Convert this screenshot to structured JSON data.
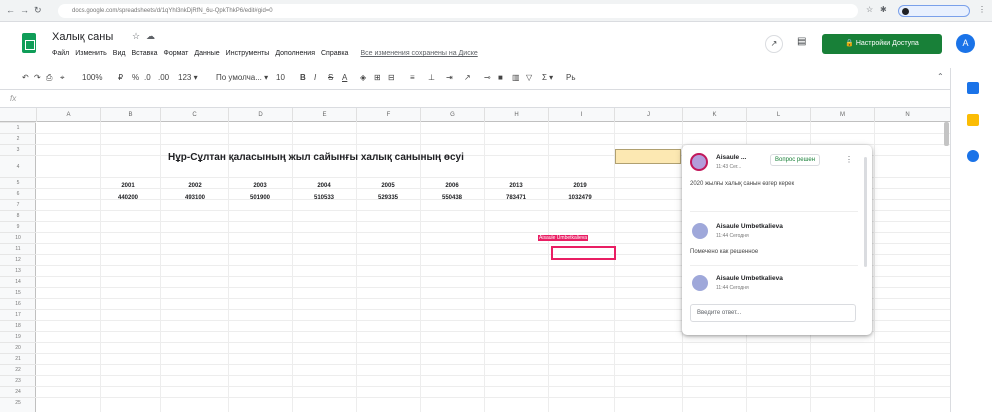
{
  "browser": {
    "url": "docs.google.com/spreadsheets/d/1qYhl3nkDjRfN_6u-QpkThkP6/edit#gid=0",
    "back_icon": "arrow-left-icon",
    "forward_icon": "arrow-right-icon",
    "reload_icon": "reload-icon"
  },
  "header": {
    "title": "Халық саны",
    "menu": [
      "Файл",
      "Изменить",
      "Вид",
      "Вставка",
      "Формат",
      "Данные",
      "Инструменты",
      "Дополнения",
      "Справка"
    ],
    "last_edit": "Все изменения сохранены на Диске",
    "share_label": "Настройки Доступа",
    "avatar_letter": "A"
  },
  "toolbar": {
    "zoom": "100%",
    "currency": "₽",
    "percent": "%",
    "dec0": ".0",
    "dec00": ".00",
    "fmt": "123 ▾",
    "font": "По умолча... ▾",
    "font_size": "10",
    "bold": "B",
    "italic": "I",
    "strike": "S",
    "text_color": "A",
    "func": "Σ ▾"
  },
  "formula_bar": {
    "fx": "fx"
  },
  "columns": [
    "A",
    "B",
    "C",
    "D",
    "E",
    "F",
    "G",
    "H",
    "I",
    "J",
    "K",
    "L",
    "M",
    "N"
  ],
  "rows": [
    "1",
    "2",
    "3",
    "4",
    "5",
    "6",
    "7",
    "8",
    "9",
    "10",
    "11",
    "12",
    "13",
    "14",
    "15",
    "16",
    "17",
    "18",
    "19",
    "20",
    "21",
    "22",
    "23",
    "24",
    "25"
  ],
  "sheet": {
    "title": "Нұр-Сұлтан қаласының жыл сайынғы халық санының өсуі",
    "years": [
      "2001",
      "2002",
      "2003",
      "2004",
      "2005",
      "2006",
      "2013",
      "2019"
    ],
    "values": [
      "440200",
      "493100",
      "501900",
      "510533",
      "529335",
      "550438",
      "783471",
      "1032479"
    ]
  },
  "collaborator_label": "Aisaule Umbetkalieva",
  "comments": {
    "resolve_label": "Вопрос решен",
    "thread": [
      {
        "name": "Aisaule ...",
        "time": "11:43 Сег...",
        "text": "2020 жылғы халық санын өзгер керек"
      },
      {
        "name": "Aisaule Umbetkalieva",
        "time": "11:44 Сегодня",
        "text": "Помечено как решенное"
      },
      {
        "name": "Aisaule Umbetkalieva",
        "time": "11:44 Сегодня",
        "text": ""
      }
    ],
    "reply_placeholder": "Введите ответ..."
  },
  "colors": {
    "share": "#188038",
    "highlight": "#fce8b2",
    "collab": "#e91e63",
    "accent": "#1a73e8"
  }
}
